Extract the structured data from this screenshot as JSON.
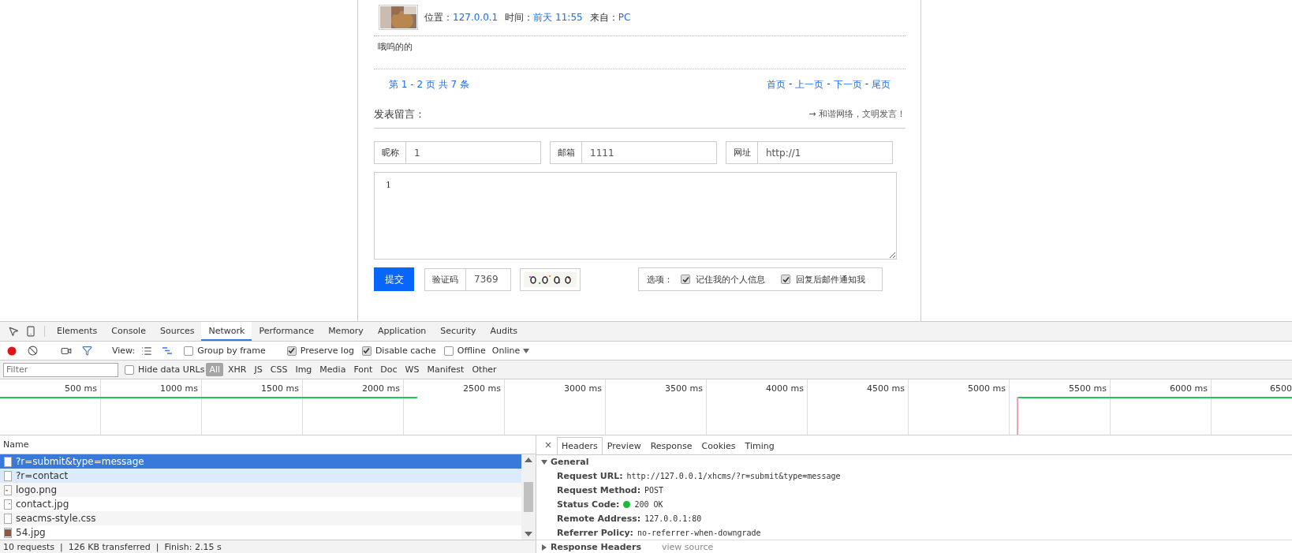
{
  "comment": {
    "meta": [
      {
        "label": "位置：",
        "value": "127.0.0.1"
      },
      {
        "label": "时间：",
        "value": "前天 11:55"
      },
      {
        "label": "来自：",
        "value": "PC"
      }
    ],
    "body": "哦呜的的"
  },
  "pagination": {
    "summary": "第 1 - 2 页 共 7 条",
    "items": [
      {
        "kind": "link",
        "text": "首页"
      },
      {
        "kind": "sep",
        "text": "-"
      },
      {
        "kind": "link",
        "text": "上一页"
      },
      {
        "kind": "sep",
        "text": "-"
      },
      {
        "kind": "link",
        "text": "下一页"
      },
      {
        "kind": "sep",
        "text": "-"
      },
      {
        "kind": "link",
        "text": "尾页"
      }
    ]
  },
  "form": {
    "title": "发表留言：",
    "notice": "→ 和谐网络，文明发言！",
    "fields": [
      {
        "label": "昵称",
        "value": "1"
      },
      {
        "label": "邮箱",
        "value": "1111"
      },
      {
        "label": "网址",
        "value": "http://1"
      }
    ],
    "message": "1",
    "submit": "提交",
    "captcha": {
      "label": "验证码",
      "value": "7369"
    },
    "options": {
      "label": "选项：",
      "items": [
        {
          "label": "记住我的个人信息",
          "checked": true
        },
        {
          "label": "回复后邮件通知我",
          "checked": true
        }
      ]
    }
  },
  "devtools": {
    "tabs": [
      {
        "label": "Elements",
        "selected": false
      },
      {
        "label": "Console",
        "selected": false
      },
      {
        "label": "Sources",
        "selected": false
      },
      {
        "label": "Network",
        "selected": true
      },
      {
        "label": "Performance",
        "selected": false
      },
      {
        "label": "Memory",
        "selected": false
      },
      {
        "label": "Application",
        "selected": false
      },
      {
        "label": "Security",
        "selected": false
      },
      {
        "label": "Audits",
        "selected": false
      }
    ],
    "toolbar": {
      "recording": true,
      "view_label": "View:",
      "checkboxes": [
        {
          "label": "Group by frame",
          "checked": false
        },
        {
          "label": "Preserve log",
          "checked": true
        },
        {
          "label": "Disable cache",
          "checked": true
        },
        {
          "label": "Offline",
          "checked": false
        }
      ],
      "throttle": "Online"
    },
    "filter": {
      "placeholder": "Filter",
      "hide_data_urls": {
        "label": "Hide data URLs",
        "checked": false
      },
      "types": [
        {
          "label": "All",
          "selected": true
        },
        {
          "label": "XHR",
          "selected": false
        },
        {
          "label": "JS",
          "selected": false
        },
        {
          "label": "CSS",
          "selected": false
        },
        {
          "label": "Img",
          "selected": false
        },
        {
          "label": "Media",
          "selected": false
        },
        {
          "label": "Font",
          "selected": false
        },
        {
          "label": "Doc",
          "selected": false
        },
        {
          "label": "WS",
          "selected": false
        },
        {
          "label": "Manifest",
          "selected": false
        },
        {
          "label": "Other",
          "selected": false
        }
      ]
    },
    "timeline": {
      "ticks": [
        "500 ms",
        "1000 ms",
        "1500 ms",
        "2000 ms",
        "2500 ms",
        "3000 ms",
        "3500 ms",
        "4000 ms",
        "4500 ms",
        "5000 ms",
        "5500 ms",
        "6000 ms",
        "6500"
      ]
    },
    "requests": {
      "column": "Name",
      "rows": [
        {
          "name": "?r=submit&type=message",
          "kind": "doc",
          "selected": true,
          "highlighted": false
        },
        {
          "name": "?r=contact",
          "kind": "doc",
          "selected": false,
          "highlighted": true
        },
        {
          "name": "logo.png",
          "kind": "png",
          "selected": false,
          "highlighted": false
        },
        {
          "name": "contact.jpg",
          "kind": "jpg",
          "selected": false,
          "highlighted": false
        },
        {
          "name": "seacms-style.css",
          "kind": "doc",
          "selected": false,
          "highlighted": false
        },
        {
          "name": "54.jpg",
          "selected": false,
          "highlighted": false
        }
      ]
    },
    "status_bar": "10 requests  |  126 KB transferred  |  Finish: 2.15 s",
    "details": {
      "close": "×",
      "tabs": [
        {
          "label": "Headers",
          "selected": true
        },
        {
          "label": "Preview",
          "selected": false
        },
        {
          "label": "Response",
          "selected": false
        },
        {
          "label": "Cookies",
          "selected": false
        },
        {
          "label": "Timing",
          "selected": false
        }
      ],
      "general": {
        "title": "General",
        "expanded": true,
        "rows": [
          {
            "label": "Request URL:",
            "value": "http://127.0.0.1/xhcms/?r=submit&type=message"
          },
          {
            "label": "Request Method:",
            "value": "POST"
          },
          {
            "label": "Status Code:",
            "value": "200 OK",
            "color": "#1db83f"
          },
          {
            "label": "Remote Address:",
            "value": "127.0.0.1:80"
          },
          {
            "label": "Referrer Policy:",
            "value": "no-referrer-when-downgrade"
          }
        ]
      },
      "response_headers": {
        "title": "Response Headers",
        "expanded": false,
        "link": "view source"
      }
    }
  }
}
